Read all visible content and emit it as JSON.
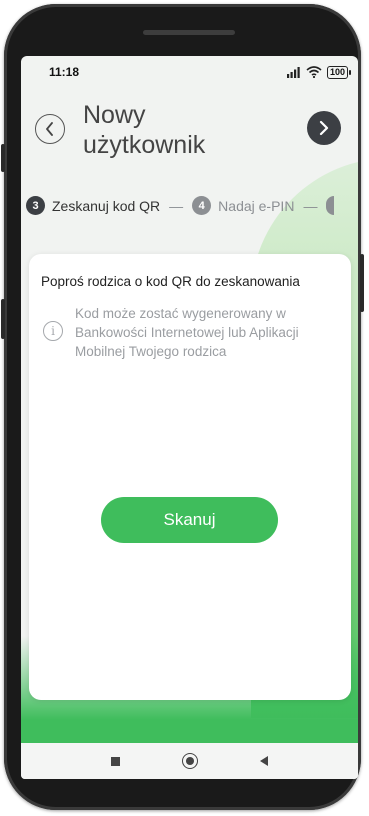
{
  "status_bar": {
    "time": "11:18",
    "battery": "100"
  },
  "header": {
    "title_line1": "Nowy",
    "title_line2": "użytkownik"
  },
  "steps": [
    {
      "number": "3",
      "label": "Zeskanuj kod QR",
      "state": "active"
    },
    {
      "number": "4",
      "label": "Nadaj e-PIN",
      "state": "inactive"
    }
  ],
  "step_separator": "—",
  "card": {
    "title": "Poproś rodzica o kod QR do zeskanowania",
    "info_text": "Kod może zostać wygenerowany w Bankowości Internetowej lub Aplikacji Mobilnej Twojego rodzica"
  },
  "scan_button": {
    "label": "Skanuj"
  },
  "colors": {
    "accent_green": "#3fbd5c",
    "dark_button": "#3c3f44"
  },
  "icons": [
    "back-chevron-icon",
    "next-chevron-icon",
    "info-icon",
    "signal-icon",
    "wifi-icon",
    "battery-icon"
  ]
}
